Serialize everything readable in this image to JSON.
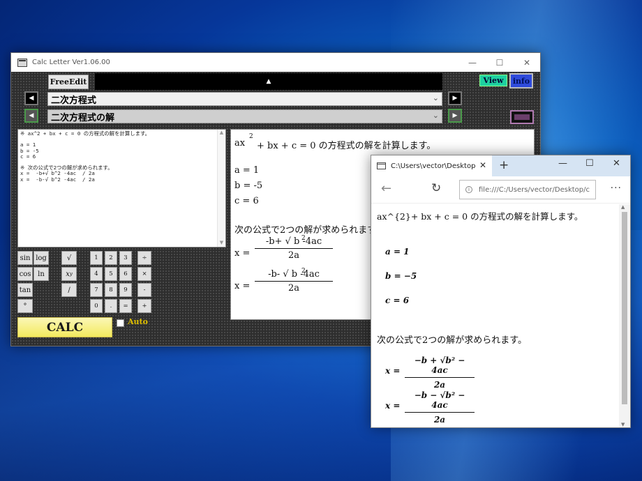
{
  "app": {
    "title": "Calc Letter  Ver1.06.00",
    "freeedit_label": "FreeEdit",
    "up_arrow": "▲",
    "view_label": "View",
    "info_label": "info",
    "category_select": "二次方程式",
    "item_select": "二次方程式の解",
    "editor_text": "※ ax^2 + bx + c = 0 の方程式の解を計算します。\n\na = 1\nb = -5\nc = 6\n\n※ 次の公式で2つの解が求められます。\nx =  -b+√ b^2 -4ac  / 2a\nx =  -b-√ b^2 -4ac  / 2a",
    "keys": {
      "sin": "sin",
      "log": "log",
      "sqrt": "√",
      "cos": "cos",
      "ln": "ln",
      "pow": "x",
      "pow_sup": "y",
      "tan": "tan",
      "slash": "/",
      "deg": "°",
      "k1": "1",
      "k2": "2",
      "k3": "3",
      "div": "÷",
      "k4": "4",
      "k5": "5",
      "k6": "6",
      "mul": "×",
      "k7": "7",
      "k8": "8",
      "k9": "9",
      "minus": "-",
      "k0": "0",
      "dot": ".",
      "eq": "=",
      "plus": "+"
    },
    "calc_label": "CALC",
    "auto_label": "Auto",
    "viewer": {
      "line1_a": "ax",
      "line1_sup": "2",
      "line1_b": "+ bx + c = 0 の方程式の解を計算します。",
      "a": "a = 1",
      "b": "b = -5",
      "c": "c = 6",
      "formula_intro": "次の公式で2つの解が求められます。",
      "x_eq": "x =",
      "num1": "-b+ √ b  -4ac",
      "num2": "-b- √ b  -4ac",
      "num_sup": "2",
      "den": "2a"
    }
  },
  "browser": {
    "tab_title": "C:\\Users\\vector\\Desktop",
    "tab_close": "✕",
    "new_tab": "+",
    "minimize": "—",
    "maximize": "☐",
    "close": "✕",
    "back": "←",
    "refresh": "↻",
    "url": "file:///C:/Users/vector/Desktop/c",
    "more": "···",
    "line1": "ax^{2}+ bx + c = 0 の方程式の解を計算します。",
    "a": "a = 1",
    "b": "b = −5",
    "c": "c = 6",
    "formula_intro": "次の公式で2つの解が求められます。",
    "x_eq": "x =",
    "num1": "−b + √b² − 4ac",
    "num2": "−b − √b² − 4ac",
    "den": "2a"
  }
}
